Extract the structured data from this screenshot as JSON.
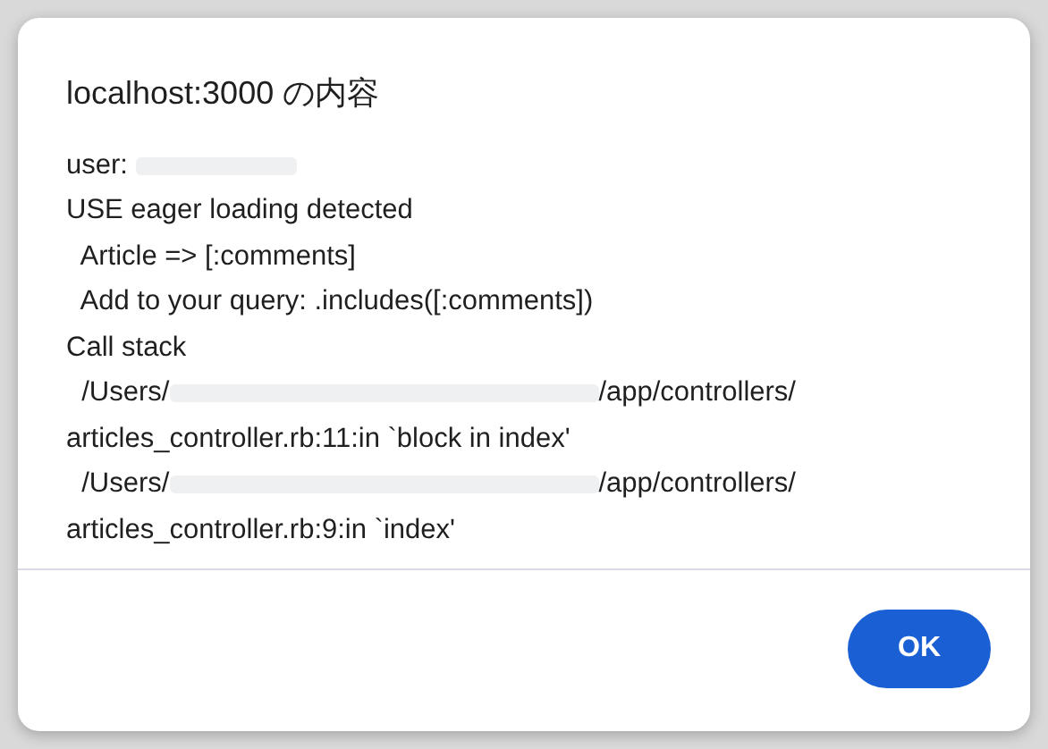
{
  "dialog": {
    "title": "localhost:3000 の内容",
    "message_lines": [
      {
        "text": "user: ",
        "redacted": true
      },
      {
        "text": "USE eager loading detected",
        "redacted": false
      },
      {
        "text": "  Article => [:comments]",
        "redacted": false
      },
      {
        "text": "  Add to your query: .includes([:comments])",
        "redacted": false
      },
      {
        "text": "Call stack",
        "redacted": false
      },
      {
        "text": "  /Users/",
        "redacted": true,
        "after": "/app/controllers/"
      },
      {
        "text": "articles_controller.rb:11:in `block in index'",
        "redacted": false
      },
      {
        "text": "  /Users/",
        "redacted": true,
        "after": "/app/controllers/"
      },
      {
        "text": "articles_controller.rb:9:in `index'",
        "redacted": false
      }
    ],
    "buttons": [
      {
        "label": "OK"
      }
    ]
  }
}
